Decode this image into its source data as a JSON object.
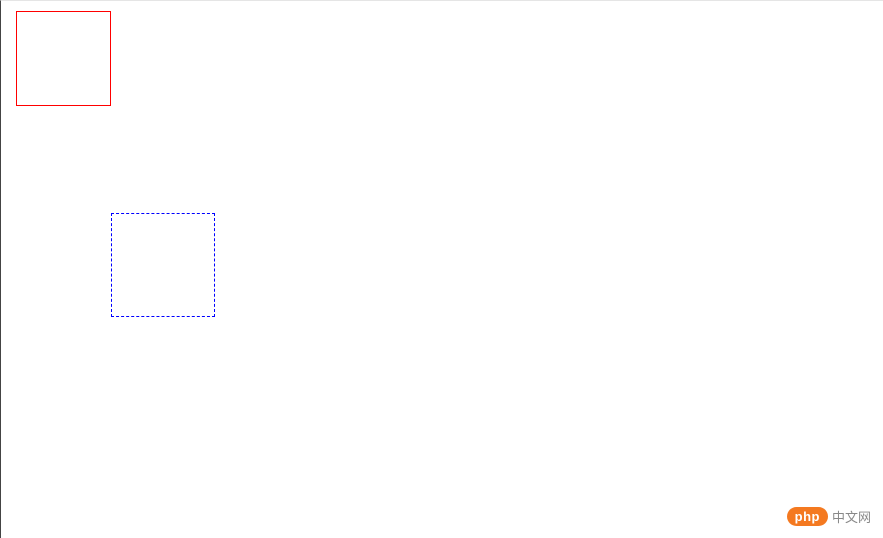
{
  "boxes": {
    "red": {
      "border_color": "#ff0000",
      "border_style": "solid"
    },
    "blue": {
      "border_color": "#0000ff",
      "border_style": "dashed"
    }
  },
  "watermark": {
    "badge_text": "php",
    "label_text": "中文网",
    "badge_bg": "#f47920",
    "label_color": "#888888"
  }
}
